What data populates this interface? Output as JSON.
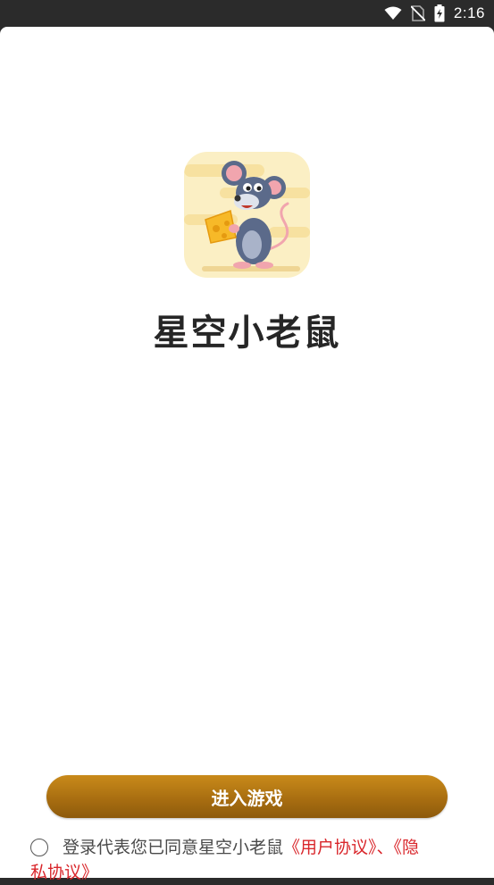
{
  "status_bar": {
    "time": "2:16",
    "icons": [
      "wifi-icon",
      "no-sim-icon",
      "battery-charging-icon"
    ]
  },
  "app": {
    "name": "星空小老鼠",
    "icon": "mouse-with-cheese-app-icon"
  },
  "actions": {
    "enter_game_label": "进入游戏"
  },
  "agreement": {
    "checked": false,
    "text": "登录代表您已同意星空小老鼠",
    "user_agreement": "《用户协议》",
    "separator": "、",
    "privacy_policy": "《隐私协议》"
  },
  "colors": {
    "button_gradient_top": "#c98a1a",
    "button_gradient_bottom": "#8d5a0c",
    "link": "#d9262b",
    "status_bar_bg": "#2b2b2b"
  }
}
